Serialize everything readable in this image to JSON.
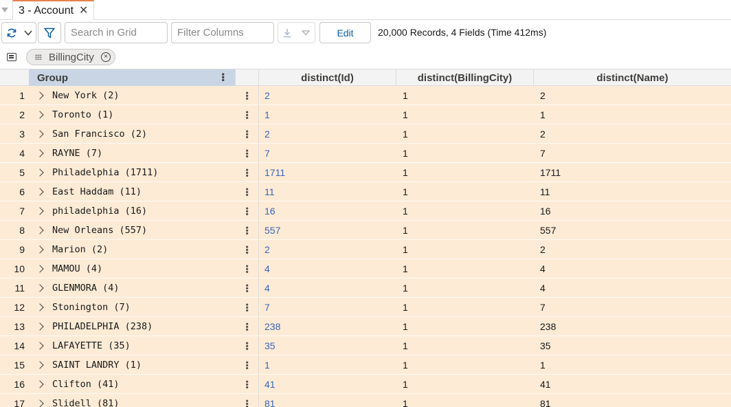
{
  "tab": {
    "label": "3 - Account",
    "close_glyph": "✕"
  },
  "toolbar": {
    "search_placeholder": "Search in Grid",
    "filter_placeholder": "Filter Columns",
    "edit_label": "Edit",
    "status": "20,000 Records, 4 Fields (Time 412ms)",
    "icons": [
      "refresh-icon",
      "chevron-down-icon",
      "filter-icon",
      "export-icon"
    ],
    "accent_color": "#0b5cab"
  },
  "group_by": {
    "chip_label": "BillingCity",
    "remove_glyph": "×"
  },
  "grid": {
    "columns": [
      "Group",
      "distinct(Id)",
      "distinct(BillingCity)",
      "distinct(Name)"
    ],
    "row_color": "#fdebd6",
    "rows": [
      {
        "num": "1",
        "group": "New York (2)",
        "id": "2",
        "city": "1",
        "name": "2"
      },
      {
        "num": "2",
        "group": "Toronto (1)",
        "id": "1",
        "city": "1",
        "name": "1"
      },
      {
        "num": "3",
        "group": "San Francisco (2)",
        "id": "2",
        "city": "1",
        "name": "2"
      },
      {
        "num": "4",
        "group": "RAYNE (7)",
        "id": "7",
        "city": "1",
        "name": "7"
      },
      {
        "num": "5",
        "group": "Philadelphia (1711)",
        "id": "1711",
        "city": "1",
        "name": "1711"
      },
      {
        "num": "6",
        "group": "East Haddam (11)",
        "id": "11",
        "city": "1",
        "name": "11"
      },
      {
        "num": "7",
        "group": "philadelphia (16)",
        "id": "16",
        "city": "1",
        "name": "16"
      },
      {
        "num": "8",
        "group": "New Orleans (557)",
        "id": "557",
        "city": "1",
        "name": "557"
      },
      {
        "num": "9",
        "group": "Marion (2)",
        "id": "2",
        "city": "1",
        "name": "2"
      },
      {
        "num": "10",
        "group": "MAMOU (4)",
        "id": "4",
        "city": "1",
        "name": "4"
      },
      {
        "num": "11",
        "group": "GLENMORA (4)",
        "id": "4",
        "city": "1",
        "name": "4"
      },
      {
        "num": "12",
        "group": "Stonington (7)",
        "id": "7",
        "city": "1",
        "name": "7"
      },
      {
        "num": "13",
        "group": "PHILADELPHIA (238)",
        "id": "238",
        "city": "1",
        "name": "238"
      },
      {
        "num": "14",
        "group": "LAFAYETTE (35)",
        "id": "35",
        "city": "1",
        "name": "35"
      },
      {
        "num": "15",
        "group": "SAINT LANDRY (1)",
        "id": "1",
        "city": "1",
        "name": "1"
      },
      {
        "num": "16",
        "group": "Clifton (41)",
        "id": "41",
        "city": "1",
        "name": "41"
      },
      {
        "num": "17",
        "group": "Slidell (81)",
        "id": "81",
        "city": "1",
        "name": "81"
      }
    ]
  }
}
